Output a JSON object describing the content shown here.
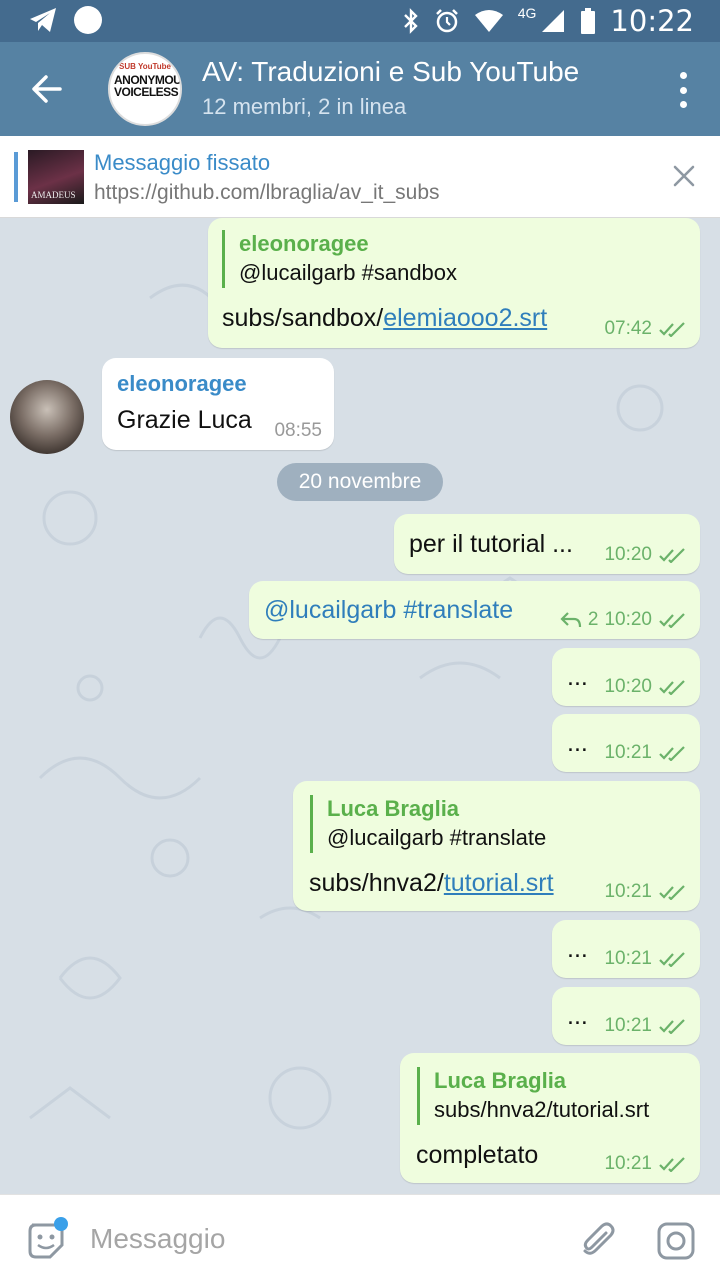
{
  "status_bar": {
    "network": "4G",
    "time": "10:22",
    "icons": [
      "telegram-icon",
      "circle-icon",
      "bluetooth-icon",
      "alarm-icon",
      "wifi-icon",
      "signal-icon",
      "battery-icon"
    ]
  },
  "header": {
    "title": "AV: Traduzioni e Sub YouTube",
    "subtitle": "12 membri, 2 in linea",
    "avatar_top": "SUB YouTube",
    "avatar_main": "ANONYMOUS VOICELESS"
  },
  "pinned": {
    "label": "Messaggio fissato",
    "text": "https://github.com/lbraglia/av_it_subs",
    "thumb_text": "AMADEUS"
  },
  "messages": [
    {
      "reply_name": "eleonoragee",
      "reply_text": "@lucailgarb #sandbox",
      "text_prefix": "subs/sandbox/",
      "link": "elemiaooo2.srt",
      "time": "07:42"
    },
    {
      "sender": "eleonoragee",
      "text": "Grazie Luca",
      "time": "08:55"
    },
    {
      "text": "per il tutorial ...",
      "time": "10:20"
    },
    {
      "text": "@lucailgarb #translate",
      "replies": "2",
      "time": "10:20"
    },
    {
      "text": "...",
      "time": "10:20"
    },
    {
      "text": "...",
      "time": "10:21"
    },
    {
      "reply_name": "Luca Braglia",
      "reply_text": "@lucailgarb #translate",
      "text_prefix": "subs/hnva2/",
      "link": "tutorial.srt",
      "time": "10:21"
    },
    {
      "text": "...",
      "time": "10:21"
    },
    {
      "text": "...",
      "time": "10:21"
    },
    {
      "reply_name": "Luca Braglia",
      "reply_text": "subs/hnva2/tutorial.srt",
      "text": "completato",
      "time": "10:21"
    }
  ],
  "date_separator": "20 novembre",
  "input": {
    "placeholder": "Messaggio"
  },
  "colors": {
    "header": "#5682a3",
    "status_bar": "#446b8e",
    "outgoing_bubble": "#effdde",
    "check_green": "#6bb26a",
    "link_blue": "#2f7ebb"
  }
}
